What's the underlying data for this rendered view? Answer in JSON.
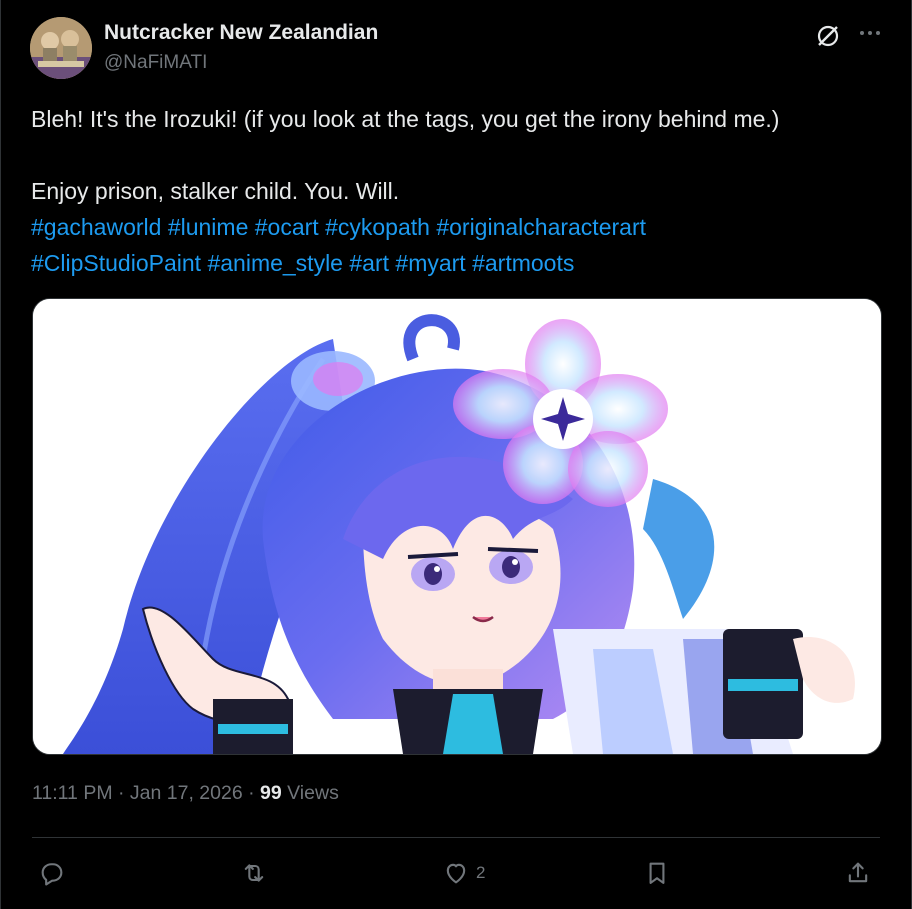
{
  "author": {
    "display_name": "Nutcracker New Zealandian",
    "handle": "@NaFiMATI"
  },
  "post": {
    "lines": [
      "Bleh! It's the Irozuki! (if you look at the tags, you get the irony behind me.)",
      "Enjoy prison, stalker child. You. Will."
    ],
    "hashtags_line1": [
      "#gachaworld",
      "#lunime",
      "#ocart",
      "#cykopath",
      "#originalcharacterart"
    ],
    "hashtags_line2": [
      "#ClipStudioPaint",
      "#anime_style",
      "#art",
      "#myart",
      "#artmoots"
    ]
  },
  "meta": {
    "time": "11:11 PM",
    "sep1": " · ",
    "date": "Jan 17, 2026",
    "sep2": " · ",
    "views_count": "99",
    "views_label": " Views"
  },
  "actions": {
    "reply_count": "",
    "repost_count": "",
    "like_count": "2"
  },
  "colors": {
    "background": "#000000",
    "text": "#e7e9ea",
    "secondary": "#71767b",
    "link": "#1d9bf0",
    "border": "#2f3336"
  },
  "icons": [
    "grok-icon",
    "more-icon",
    "reply-icon",
    "repost-icon",
    "like-icon",
    "bookmark-icon",
    "share-icon"
  ]
}
